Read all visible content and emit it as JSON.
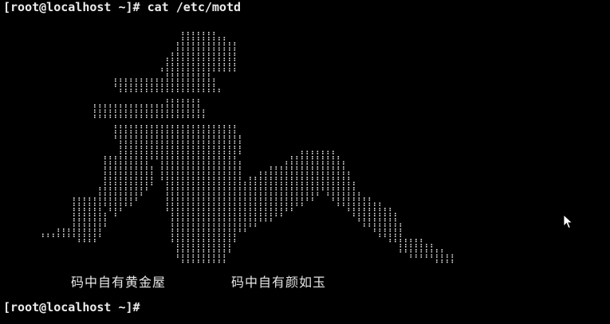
{
  "terminal": {
    "lines": [
      {
        "prompt": "[root@localhost ~]#",
        "command": "cat /etc/motd"
      },
      {
        "prompt": "[root@localhost ~]#",
        "command": ""
      }
    ],
    "captions": [
      "码中自有黄金屋",
      "码中自有颜如玉"
    ],
    "colors": {
      "background": "#000000",
      "foreground": "#e6e6e6"
    },
    "art_glyph": ":"
  }
}
